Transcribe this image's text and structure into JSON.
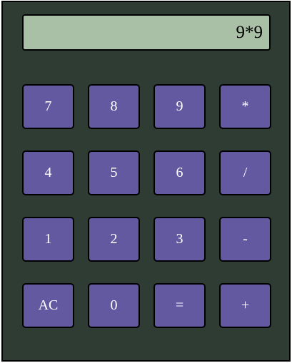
{
  "display": {
    "value": "9*9"
  },
  "keys": {
    "row1": [
      "7",
      "8",
      "9",
      "*"
    ],
    "row2": [
      "4",
      "5",
      "6",
      "/"
    ],
    "row3": [
      "1",
      "2",
      "3",
      "-"
    ],
    "row4": [
      "AC",
      "0",
      "=",
      "+"
    ]
  },
  "colors": {
    "body": "#2f3c33",
    "display": "#a9c0a6",
    "key": "#6259a0",
    "key_text": "#ffffff",
    "border": "#000000"
  }
}
